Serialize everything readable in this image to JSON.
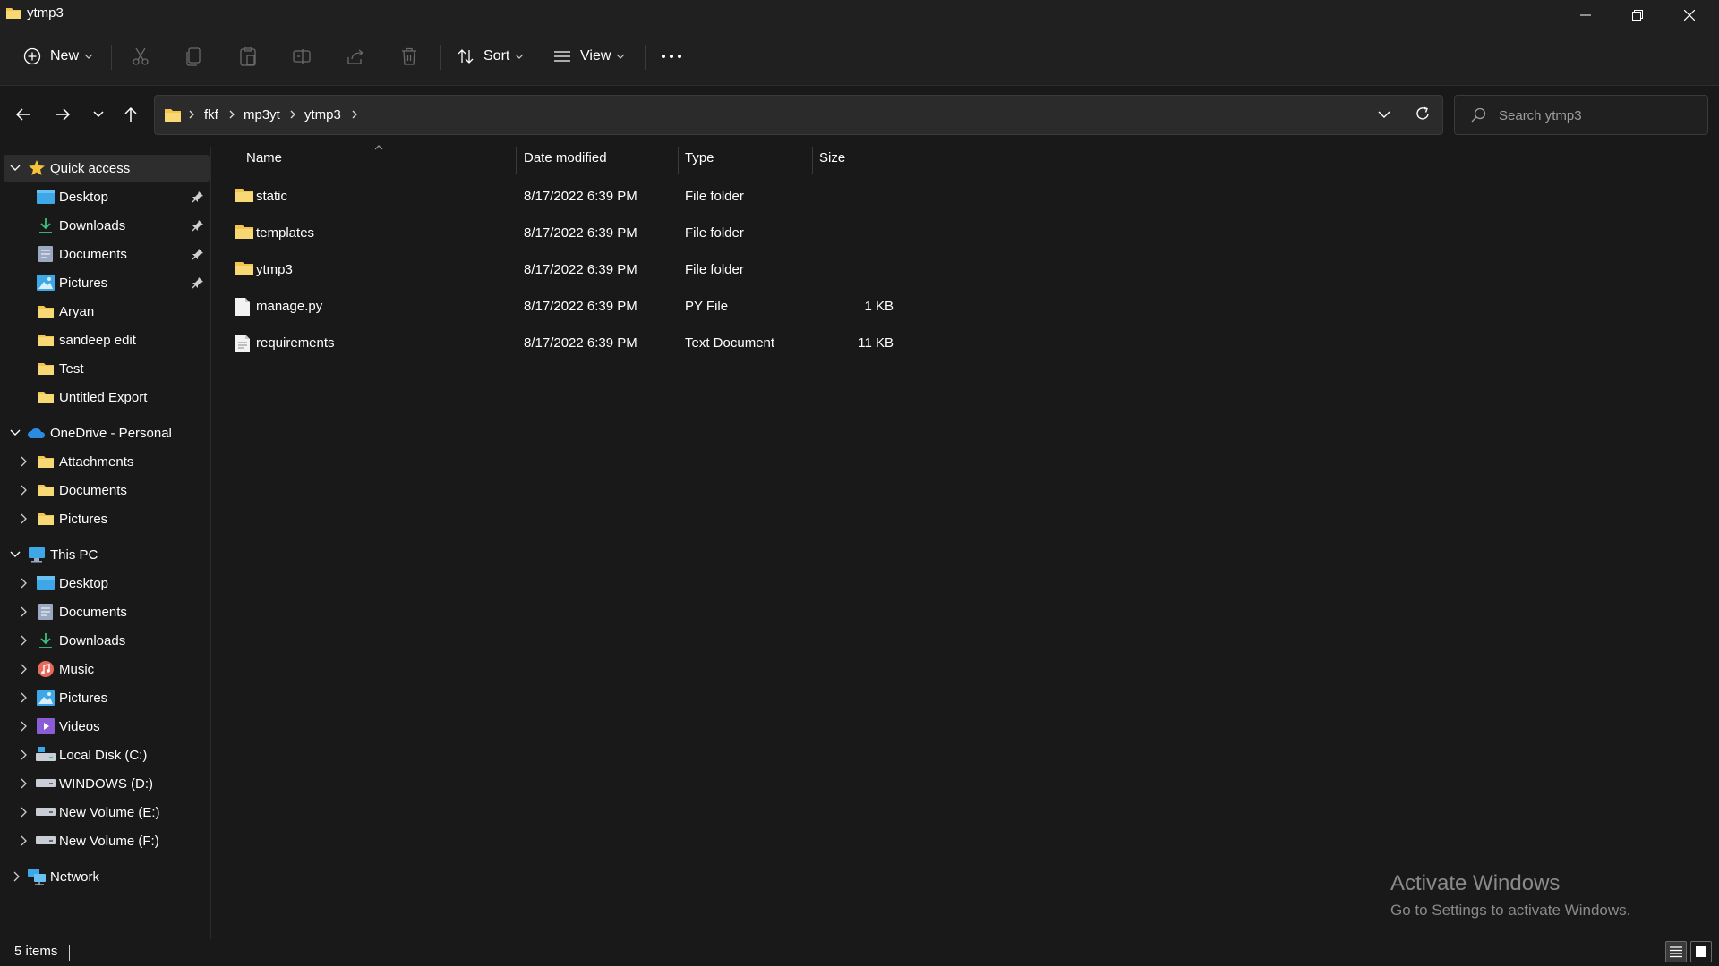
{
  "window": {
    "title": "ytmp3"
  },
  "toolbar": {
    "new_label": "New",
    "sort_label": "Sort",
    "view_label": "View"
  },
  "address": {
    "crumbs": [
      "fkf",
      "mp3yt",
      "ytmp3"
    ]
  },
  "search": {
    "placeholder": "Search ytmp3"
  },
  "sidebar": {
    "quick_access": {
      "label": "Quick access",
      "items": [
        {
          "label": "Desktop",
          "icon": "desktop-icon",
          "pinned": true
        },
        {
          "label": "Downloads",
          "icon": "downloads-icon",
          "pinned": true
        },
        {
          "label": "Documents",
          "icon": "documents-icon",
          "pinned": true
        },
        {
          "label": "Pictures",
          "icon": "pictures-icon",
          "pinned": true
        },
        {
          "label": "Aryan",
          "icon": "folder-icon"
        },
        {
          "label": "sandeep edit",
          "icon": "folder-icon"
        },
        {
          "label": "Test",
          "icon": "folder-icon"
        },
        {
          "label": "Untitled Export",
          "icon": "folder-icon"
        }
      ]
    },
    "onedrive": {
      "label": "OneDrive - Personal",
      "items": [
        {
          "label": "Attachments",
          "icon": "folder-icon"
        },
        {
          "label": "Documents",
          "icon": "folder-icon"
        },
        {
          "label": "Pictures",
          "icon": "folder-icon"
        }
      ]
    },
    "this_pc": {
      "label": "This PC",
      "items": [
        {
          "label": "Desktop",
          "icon": "desktop-icon"
        },
        {
          "label": "Documents",
          "icon": "documents-icon"
        },
        {
          "label": "Downloads",
          "icon": "downloads-icon"
        },
        {
          "label": "Music",
          "icon": "music-icon"
        },
        {
          "label": "Pictures",
          "icon": "pictures-icon"
        },
        {
          "label": "Videos",
          "icon": "videos-icon"
        },
        {
          "label": "Local Disk (C:)",
          "icon": "local-disk-icon"
        },
        {
          "label": "WINDOWS (D:)",
          "icon": "drive-icon"
        },
        {
          "label": "New Volume (E:)",
          "icon": "drive-icon"
        },
        {
          "label": "New Volume (F:)",
          "icon": "drive-icon"
        }
      ]
    },
    "network": {
      "label": "Network"
    }
  },
  "columns": {
    "name": "Name",
    "date": "Date modified",
    "type": "Type",
    "size": "Size"
  },
  "files": [
    {
      "name": "static",
      "date": "8/17/2022 6:39 PM",
      "type": "File folder",
      "size": "",
      "icon": "folder-icon"
    },
    {
      "name": "templates",
      "date": "8/17/2022 6:39 PM",
      "type": "File folder",
      "size": "",
      "icon": "folder-icon"
    },
    {
      "name": "ytmp3",
      "date": "8/17/2022 6:39 PM",
      "type": "File folder",
      "size": "",
      "icon": "folder-icon"
    },
    {
      "name": "manage.py",
      "date": "8/17/2022 6:39 PM",
      "type": "PY File",
      "size": "1 KB",
      "icon": "file-icon"
    },
    {
      "name": "requirements",
      "date": "8/17/2022 6:39 PM",
      "type": "Text Document",
      "size": "11 KB",
      "icon": "text-file-icon"
    }
  ],
  "watermark": {
    "title": "Activate Windows",
    "subtitle": "Go to Settings to activate Windows."
  },
  "status": {
    "item_count": "5 items"
  },
  "colors": {
    "folder": "#f3c54f",
    "accent": "#4cc2ff"
  }
}
